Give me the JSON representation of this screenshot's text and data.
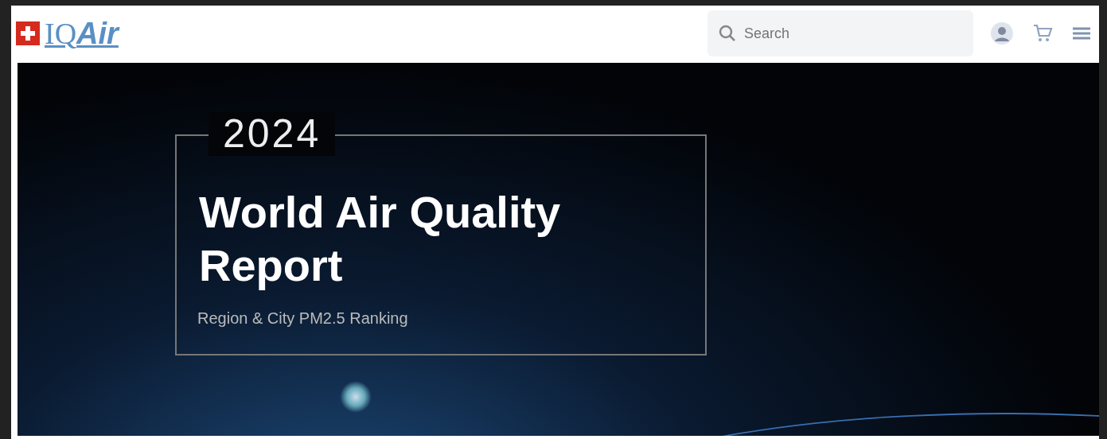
{
  "header": {
    "logo": {
      "text_plain": "IQ",
      "text_italic": "Air"
    },
    "search": {
      "placeholder": "Search"
    }
  },
  "hero": {
    "year": "2024",
    "title": "World Air Quality Report",
    "subtitle": "Region & City PM2.5 Ranking"
  }
}
